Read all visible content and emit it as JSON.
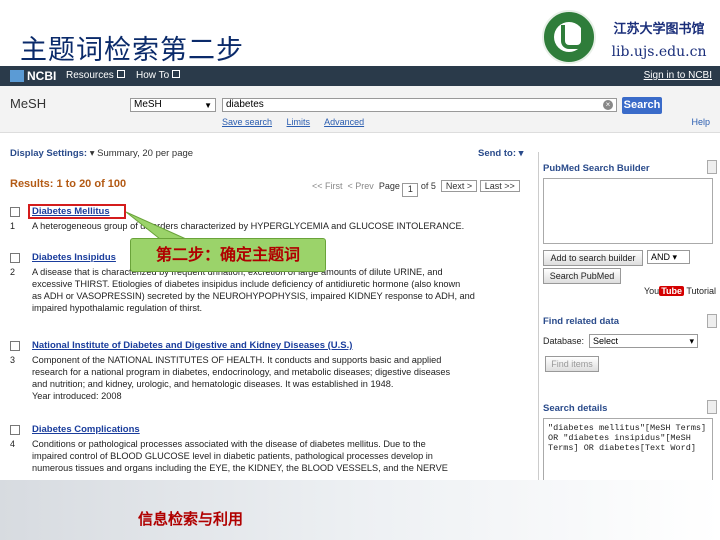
{
  "slide": {
    "title": "主题词检索第二步",
    "library_name": "江苏大学图书馆",
    "library_url": "lib.ujs.edu.cn",
    "footer": "信息检索与利用"
  },
  "ncbi": {
    "logo": "NCBI",
    "resources": "Resources",
    "how_to": "How To",
    "sign_in": "Sign in to NCBI"
  },
  "search": {
    "db_label": "MeSH",
    "db_select": "MeSH",
    "term": "diabetes",
    "search_button": "Search",
    "save_search": "Save search",
    "limits": "Limits",
    "advanced": "Advanced",
    "help": "Help"
  },
  "display": {
    "settings": "Display Settings:",
    "format": "Summary, 20 per page",
    "send_to": "Send to:"
  },
  "results": {
    "count": "Results: 1 to 20 of 100",
    "pager": {
      "first": "<< First",
      "prev": "< Prev",
      "page_label": "Page",
      "page": "1",
      "of": "of 5",
      "next": "Next >",
      "last": "Last >>"
    },
    "items": [
      {
        "num": "1",
        "title": "Diabetes Mellitus",
        "desc": "A heterogeneous group of disorders characterized by HYPERGLYCEMIA and GLUCOSE INTOLERANCE."
      },
      {
        "num": "2",
        "title": "Diabetes Insipidus",
        "desc_lines": [
          "A disease that is characterized by frequent urination, excretion of large amounts of dilute URINE, and",
          "excessive THIRST. Etiologies of diabetes insipidus include deficiency of antidiuretic hormone (also known",
          "as ADH or VASOPRESSIN) secreted by the NEUROHYPOPHYSIS, impaired KIDNEY response to ADH, and",
          "impaired hypothalamic regulation of thirst."
        ]
      },
      {
        "num": "3",
        "title": "National Institute of Diabetes and Digestive and Kidney Diseases (U.S.)",
        "desc_lines": [
          "Component of the NATIONAL INSTITUTES OF HEALTH. It conducts and supports basic and applied",
          "research for a national program in diabetes, endocrinology, and metabolic diseases; digestive diseases",
          "and nutrition; and kidney, urologic, and hematologic diseases. It was established in 1948."
        ],
        "meta": "Year introduced: 2008"
      },
      {
        "num": "4",
        "title": "Diabetes Complications",
        "desc_lines": [
          "Conditions or pathological processes associated with the disease of diabetes mellitus. Due to the",
          "impaired control of BLOOD GLUCOSE level in diabetic patients, pathological processes develop in",
          "numerous tissues and organs including the EYE, the KIDNEY, the BLOOD VESSELS, and the NERVE"
        ]
      }
    ]
  },
  "callout": "第二步：确定主题词",
  "panel": {
    "builder_title": "PubMed Search Builder",
    "add_button": "Add to search builder",
    "and_select": "AND",
    "search_pubmed": "Search PubMed",
    "you": "You",
    "tube": "Tube",
    "tutorial": "Tutorial",
    "related_title": "Find related data",
    "database_label": "Database:",
    "database_select": "Select",
    "find_items": "Find items",
    "details_title": "Search details",
    "details_text": "\"diabetes mellitus\"[MeSH Terms] OR \"diabetes insipidus\"[MeSH Terms] OR diabetes[Text Word]"
  }
}
